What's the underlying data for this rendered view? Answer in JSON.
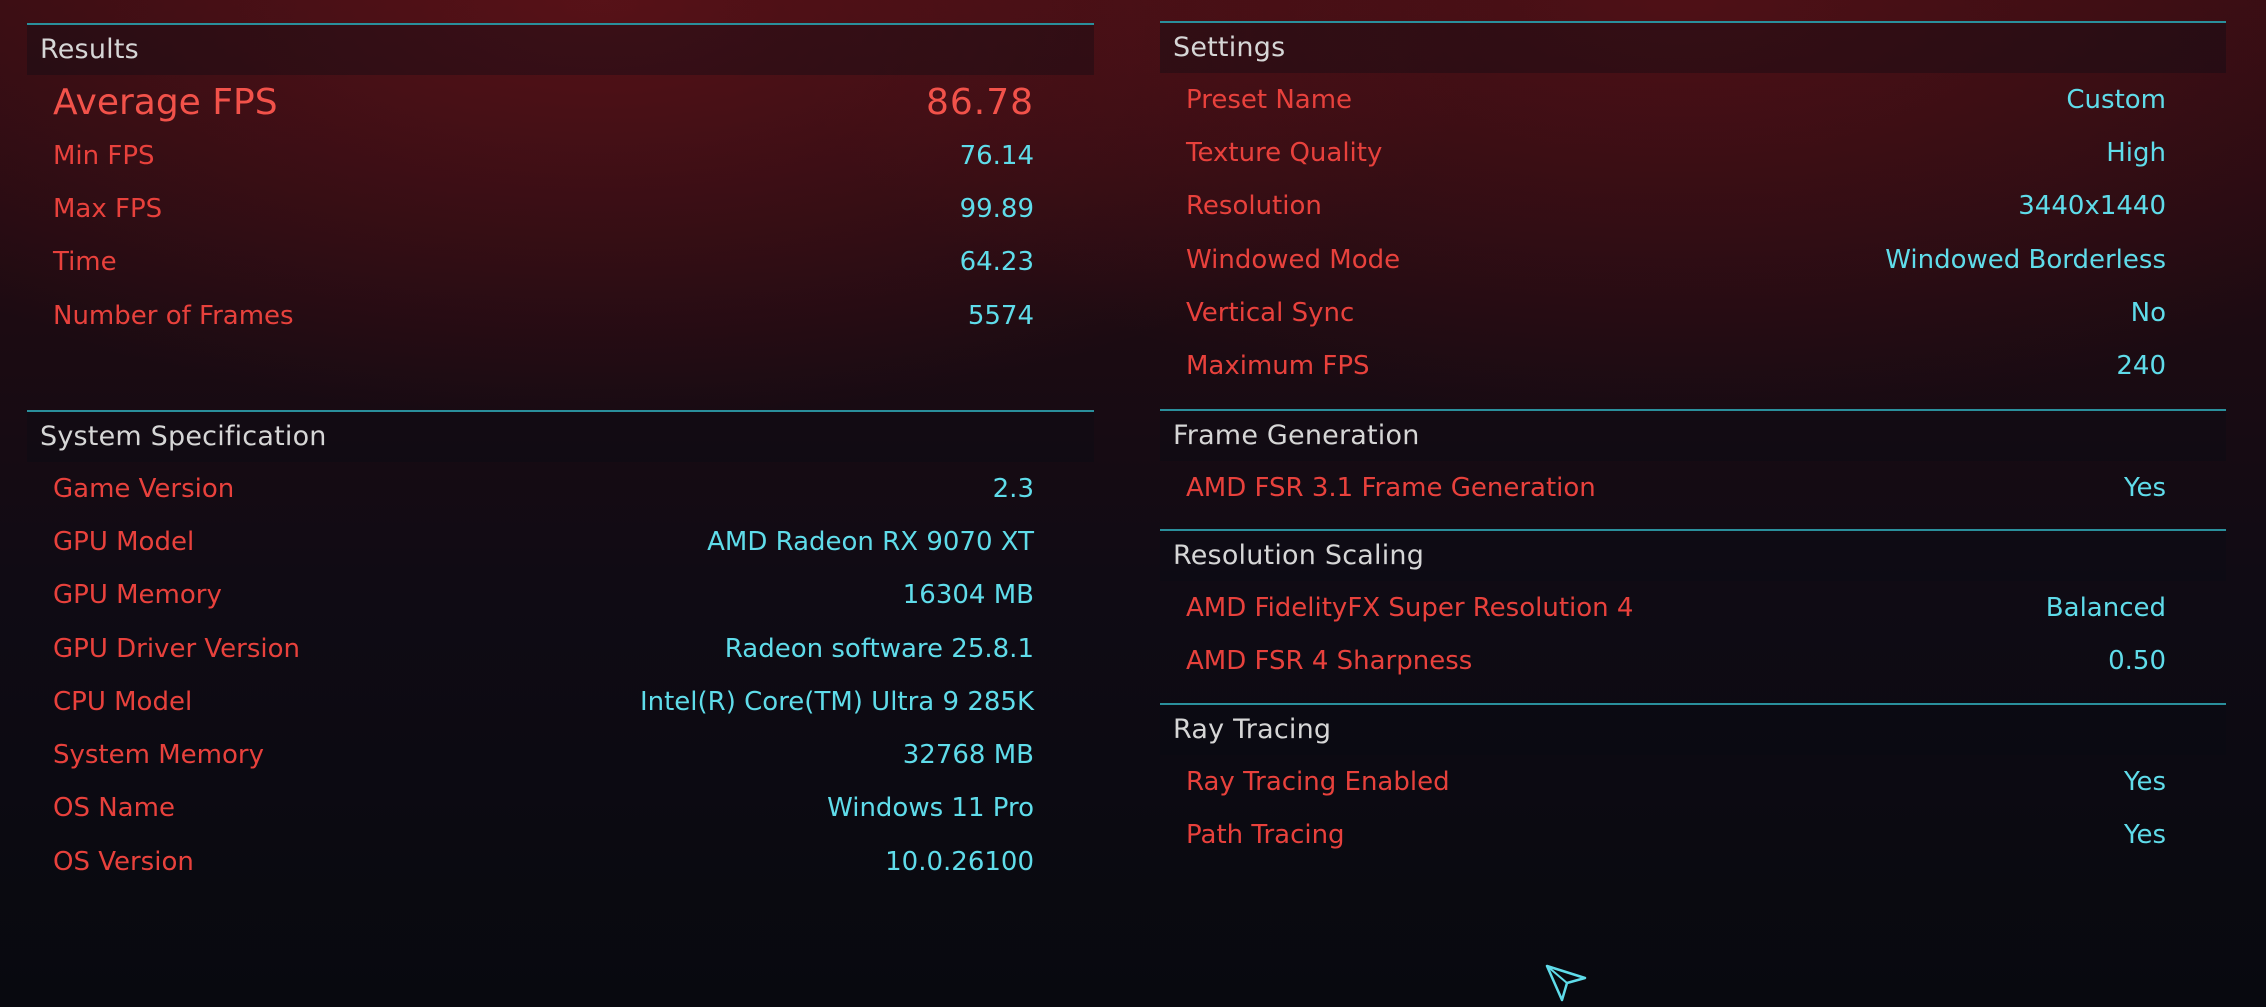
{
  "results": {
    "title": "Results",
    "average_fps": {
      "label": "Average FPS",
      "value": "86.78"
    },
    "rows": [
      {
        "label": "Min FPS",
        "value": "76.14"
      },
      {
        "label": "Max FPS",
        "value": "99.89"
      },
      {
        "label": "Time",
        "value": "64.23"
      },
      {
        "label": "Number of Frames",
        "value": "5574"
      }
    ]
  },
  "system_specification": {
    "title": "System Specification",
    "rows": [
      {
        "label": "Game Version",
        "value": "2.3"
      },
      {
        "label": "GPU Model",
        "value": "AMD Radeon RX 9070 XT"
      },
      {
        "label": "GPU Memory",
        "value": "16304 MB"
      },
      {
        "label": "GPU Driver Version",
        "value": "Radeon software 25.8.1"
      },
      {
        "label": "CPU Model",
        "value": "Intel(R) Core(TM) Ultra 9 285K"
      },
      {
        "label": "System Memory",
        "value": "32768 MB"
      },
      {
        "label": "OS Name",
        "value": "Windows 11 Pro"
      },
      {
        "label": "OS Version",
        "value": "10.0.26100"
      }
    ]
  },
  "settings": {
    "title": "Settings",
    "rows": [
      {
        "label": "Preset Name",
        "value": "Custom"
      },
      {
        "label": "Texture Quality",
        "value": "High"
      },
      {
        "label": "Resolution",
        "value": "3440x1440"
      },
      {
        "label": "Windowed Mode",
        "value": "Windowed Borderless"
      },
      {
        "label": "Vertical Sync",
        "value": "No"
      },
      {
        "label": "Maximum FPS",
        "value": "240"
      }
    ]
  },
  "frame_generation": {
    "title": "Frame Generation",
    "rows": [
      {
        "label": "AMD FSR 3.1 Frame Generation",
        "value": "Yes"
      }
    ]
  },
  "resolution_scaling": {
    "title": "Resolution Scaling",
    "rows": [
      {
        "label": "AMD FidelityFX Super Resolution 4",
        "value": "Balanced"
      },
      {
        "label": "AMD FSR 4 Sharpness",
        "value": "0.50"
      }
    ]
  },
  "ray_tracing": {
    "title": "Ray Tracing",
    "rows": [
      {
        "label": "Ray Tracing Enabled",
        "value": "Yes"
      },
      {
        "label": "Path Tracing",
        "value": "Yes"
      }
    ]
  },
  "colors": {
    "label": "#e8413c",
    "value": "#5fdcea",
    "divider": "#2a8f9c",
    "header_text": "#d6d6d6"
  },
  "icons": {
    "cursor": "mouse-pointer-icon"
  }
}
